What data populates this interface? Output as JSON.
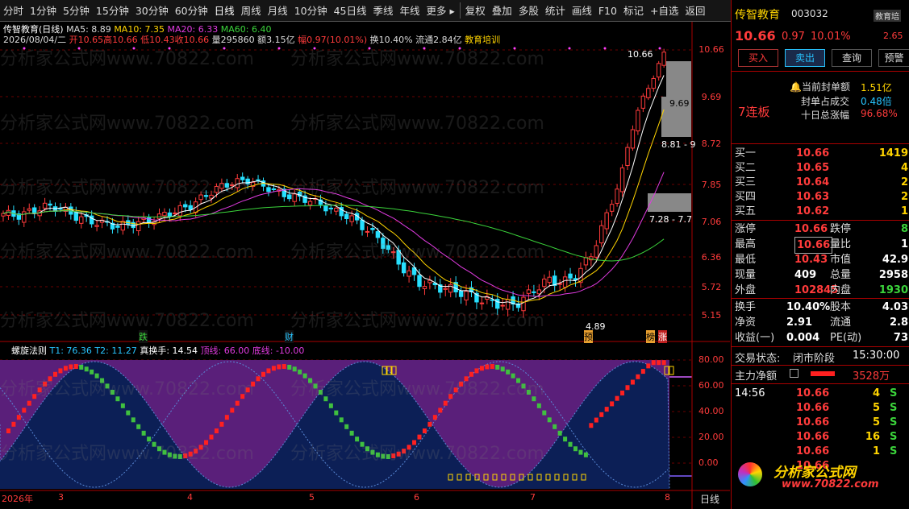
{
  "toolbar": {
    "periods": [
      "分时",
      "1分钟",
      "5分钟",
      "15分钟",
      "30分钟",
      "60分钟",
      "日线",
      "周线",
      "月线",
      "10分钟",
      "45日线",
      "季线",
      "年线",
      "更多 ▸"
    ],
    "actions": [
      "复权",
      "叠加",
      "多股",
      "统计",
      "画线",
      "F10",
      "标记",
      "+自选",
      "返回"
    ]
  },
  "chart_header": {
    "name_period": "传智教育(日线)",
    "ma5": "MA5: 8.89",
    "ma10": "MA10: 7.35",
    "ma20": "MA20: 6.33",
    "ma60": "MA60: 6.40",
    "date": "2026/08/04/二",
    "open": "开10.65",
    "high": "高10.66",
    "low": "低10.43",
    "close": "收10.66",
    "vol": "量295860",
    "amount": "额3.15亿",
    "change": "幅0.97(10.01%)",
    "turnover": "换10.40%",
    "float": "流通2.84亿",
    "sector": "教育培训"
  },
  "price_axis": [
    "10.66",
    "9.69",
    "8.72",
    "7.85",
    "7.06",
    "6.36",
    "5.72",
    "5.15"
  ],
  "osc_axis": [
    "80.00",
    "60.00",
    "40.00",
    "20.00",
    "0.00"
  ],
  "price_annotations": {
    "high_label": "10.66",
    "low_label": "4.89",
    "mid_a": "9.69",
    "mid_b": "8.81 - 9",
    "mid_c": "7.28 - 7.7"
  },
  "event_marks": [
    "跌",
    "财",
    "预",
    "榜",
    "涨"
  ],
  "osc_header": {
    "name": "螺旋法则",
    "t1": "T1: 76.36",
    "t2": "T2: 11.27",
    "zhen": "真换手: 14.54",
    "top": "顶线: 66.00",
    "bottom": "底线: -10.00"
  },
  "date_axis": [
    "2026年",
    "3",
    "4",
    "5",
    "6",
    "7",
    "8"
  ],
  "period_label": "日线",
  "watermark_text": "分析家公式网www.70822.com",
  "stock": {
    "name": "传智教育",
    "code": "003032",
    "price": "10.66",
    "change": "0.97",
    "pct": "10.01%",
    "side": "教育培",
    "side2": "2.65"
  },
  "trade_buttons": [
    "买入",
    "卖出",
    "查询",
    "预警"
  ],
  "limit_info": {
    "badge": "7连板",
    "l1": "当前封单额",
    "v1": "1.51亿",
    "l2": "封单占成交",
    "v2": "0.48倍",
    "l3": "十日总涨幅",
    "v3": "96.68%"
  },
  "orderbook": [
    {
      "label": "买一",
      "price": "10.66",
      "vol": "1419"
    },
    {
      "label": "买二",
      "price": "10.65",
      "vol": "4"
    },
    {
      "label": "买三",
      "price": "10.64",
      "vol": "2"
    },
    {
      "label": "买四",
      "price": "10.63",
      "vol": "2"
    },
    {
      "label": "买五",
      "price": "10.62",
      "vol": "1"
    }
  ],
  "quote": [
    {
      "l1": "涨停",
      "v1": "10.66",
      "l2": "跌停",
      "v2": "8"
    },
    {
      "l1": "最高",
      "v1": "10.66",
      "l2": "量比",
      "v2": "1"
    },
    {
      "l1": "最低",
      "v1": "10.43",
      "l2": "市值",
      "v2": "42.9"
    },
    {
      "l1": "现量",
      "v1": "409",
      "l2": "总量",
      "v2": "2958"
    },
    {
      "l1": "外盘",
      "v1": "102845",
      "l2": "内盘",
      "v2": "1930"
    }
  ],
  "fin": [
    {
      "l1": "换手",
      "v1": "10.40%",
      "l2": "股本",
      "v2": "4.03"
    },
    {
      "l1": "净资",
      "v1": "2.91",
      "l2": "流通",
      "v2": "2.8"
    },
    {
      "l1": "收益(一)",
      "v1": "0.004",
      "l2": "PE(动)",
      "v2": "73"
    }
  ],
  "trade_status": {
    "label": "交易状态:",
    "state": "闭市阶段",
    "time": "15:30:00"
  },
  "net_flow": {
    "label": "主力净额",
    "value": "3528万"
  },
  "ticks": [
    {
      "time": "14:56",
      "price": "10.66",
      "vol": "4",
      "side": "S"
    },
    {
      "time": "",
      "price": "10.66",
      "vol": "5",
      "side": "S"
    },
    {
      "time": "",
      "price": "10.66",
      "vol": "5",
      "side": "S"
    },
    {
      "time": "",
      "price": "10.66",
      "vol": "16",
      "side": "S"
    },
    {
      "time": "",
      "price": "10.66",
      "vol": "1",
      "side": "S"
    },
    {
      "time": "",
      "price": "10.66",
      "vol": "",
      "side": ""
    }
  ],
  "brand": {
    "name": "分析家公式网",
    "url": "www.70822.com"
  },
  "colors": {
    "up": "#ff3b3b",
    "down": "#3bd43b",
    "purple": "#5a1f7a",
    "navy": "#0c1f56"
  }
}
